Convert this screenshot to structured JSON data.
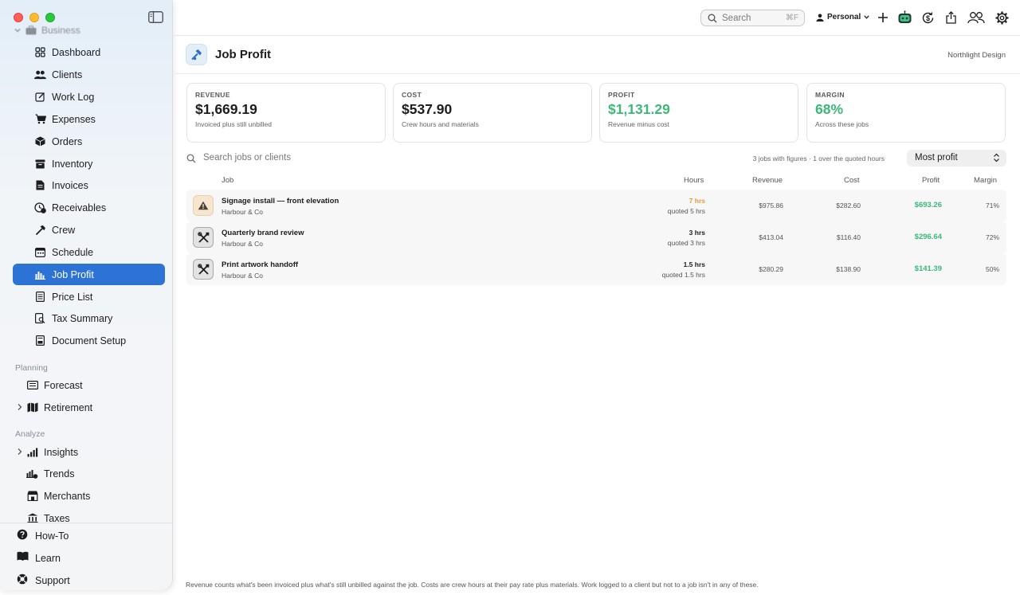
{
  "sidebar": {
    "section_top": "Business",
    "items": [
      {
        "label": "Dashboard"
      },
      {
        "label": "Clients"
      },
      {
        "label": "Work Log"
      },
      {
        "label": "Expenses"
      },
      {
        "label": "Orders"
      },
      {
        "label": "Inventory"
      },
      {
        "label": "Invoices"
      },
      {
        "label": "Receivables"
      },
      {
        "label": "Crew"
      },
      {
        "label": "Schedule"
      },
      {
        "label": "Job Profit"
      },
      {
        "label": "Price List"
      },
      {
        "label": "Tax Summary"
      },
      {
        "label": "Document Setup"
      }
    ],
    "planning_label": "Planning",
    "planning_items": [
      {
        "label": "Forecast"
      },
      {
        "label": "Retirement"
      }
    ],
    "analyze_label": "Analyze",
    "analyze_items": [
      {
        "label": "Insights"
      },
      {
        "label": "Trends"
      },
      {
        "label": "Merchants"
      },
      {
        "label": "Taxes"
      }
    ],
    "footer": [
      {
        "label": "How-To"
      },
      {
        "label": "Learn"
      },
      {
        "label": "Support"
      }
    ]
  },
  "topbar": {
    "search_placeholder": "Search",
    "search_shortcut": "⌘F",
    "profile": "Personal"
  },
  "header": {
    "title": "Job Profit",
    "company": "Northlight Design"
  },
  "kpis": [
    {
      "label": "REVENUE",
      "value": "$1,669.19",
      "note": "Invoiced plus still unbilled"
    },
    {
      "label": "COST",
      "value": "$537.90",
      "note": "Crew hours and materials"
    },
    {
      "label": "PROFIT",
      "value": "$1,131.29",
      "note": "Revenue minus cost"
    },
    {
      "label": "MARGIN",
      "value": "68%",
      "note": "Across these jobs"
    }
  ],
  "filter": {
    "search_placeholder": "Search jobs or clients",
    "summary": "3 jobs with figures · 1 over the quoted hours",
    "sort": "Most profit"
  },
  "table": {
    "columns": {
      "job": "Job",
      "hours": "Hours",
      "revenue": "Revenue",
      "cost": "Cost",
      "profit": "Profit",
      "margin": "Margin"
    },
    "rows": [
      {
        "name": "Signage install — front elevation",
        "client": "Harbour & Co",
        "hours": "7 hrs",
        "quoted": "quoted 5 hrs",
        "revenue": "$975.86",
        "cost": "$282.60",
        "profit": "$693.26",
        "margin": "71%",
        "icon": "warning-icon"
      },
      {
        "name": "Quarterly brand review",
        "client": "Harbour & Co",
        "hours": "3 hrs",
        "quoted": "quoted 3 hrs",
        "revenue": "$413.04",
        "cost": "$116.40",
        "profit": "$296.64",
        "margin": "72%",
        "icon": "tools-icon"
      },
      {
        "name": "Print artwork handoff",
        "client": "Harbour & Co",
        "hours": "1.5 hrs",
        "quoted": "quoted 1.5 hrs",
        "revenue": "$280.29",
        "cost": "$138.90",
        "profit": "$141.39",
        "margin": "50%",
        "icon": "tools-icon"
      }
    ]
  },
  "footnote": "Revenue counts what's been invoiced plus what's still unbilled against the job. Costs are crew hours at their pay rate plus materials. Work logged to a client but not to a job isn't in any of these.",
  "colors": {
    "accent": "#2d73d6",
    "profit": "#3cb878",
    "over_hours": "#e69b3a"
  }
}
